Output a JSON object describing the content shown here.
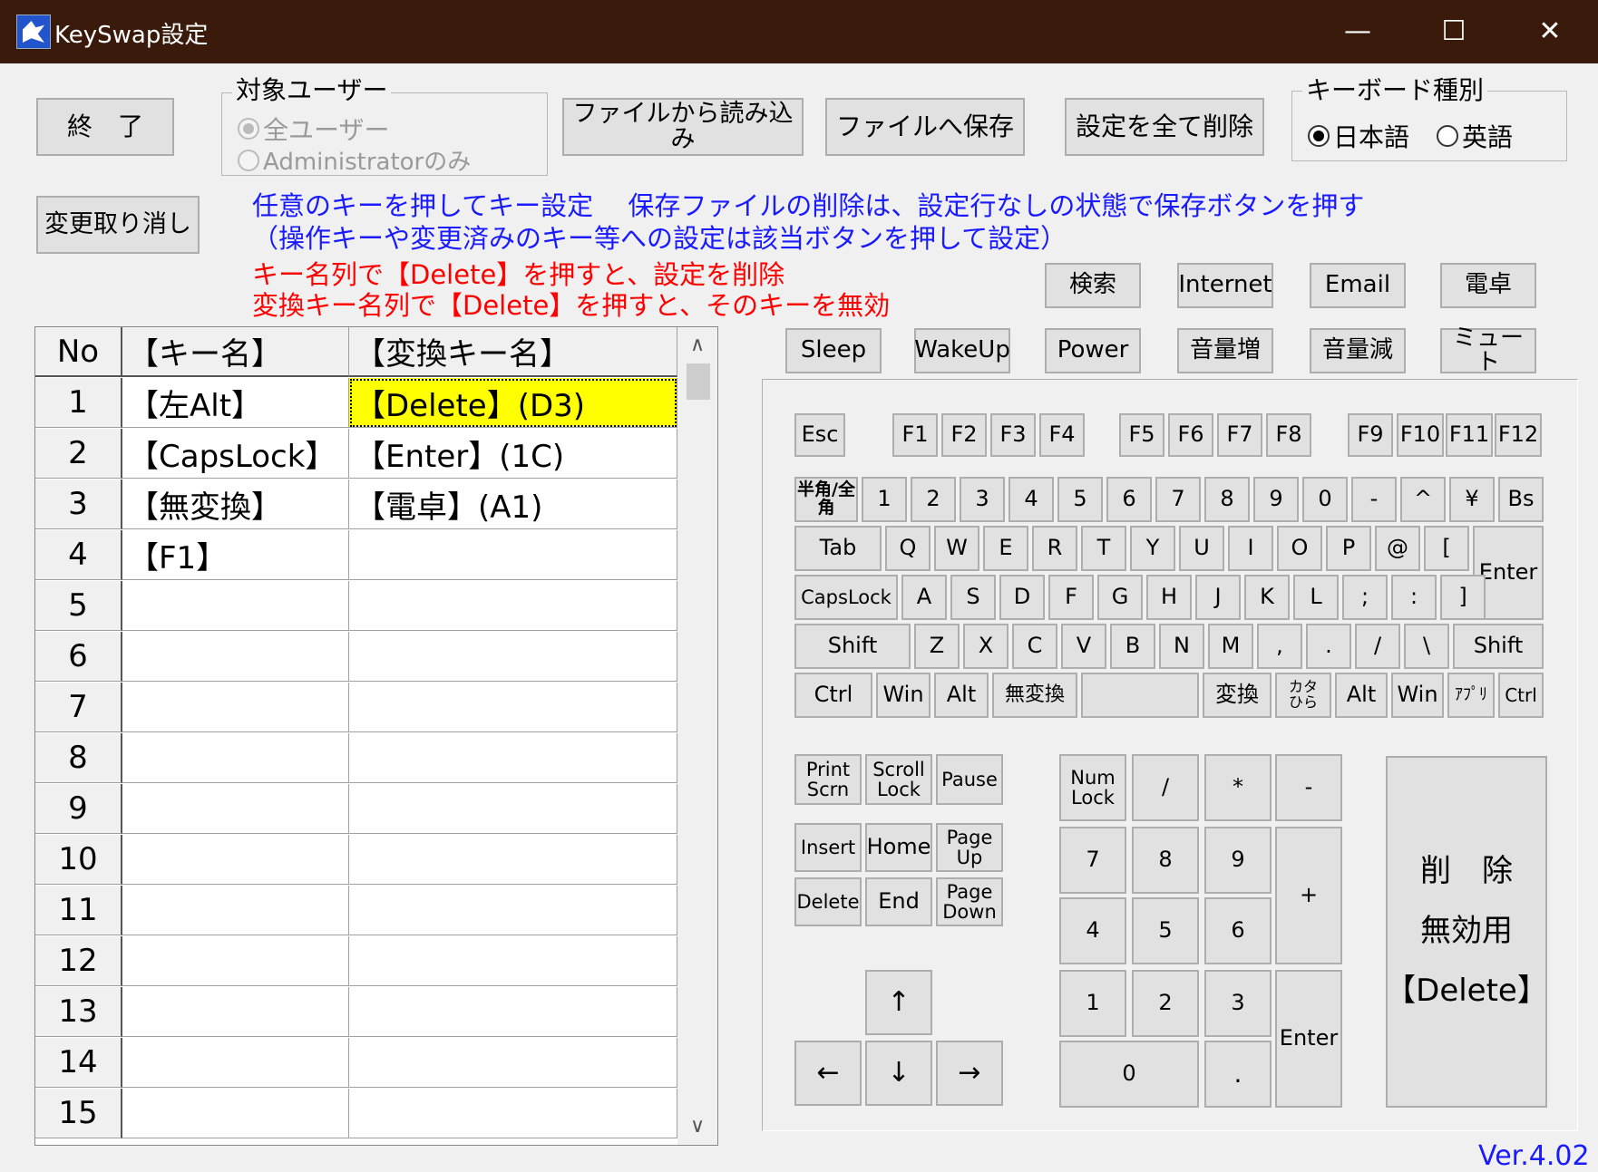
{
  "window": {
    "title": "KeySwap設定",
    "controls": {
      "minimize": "—",
      "maximize": "☐",
      "close": "✕"
    }
  },
  "toolbar": {
    "exit_label": "終　了",
    "undo_label": "変更取り消し",
    "load_label": "ファイルから読み込み",
    "save_label": "ファイルへ保存",
    "delete_all_label": "設定を全て削除"
  },
  "target_user": {
    "legend": "対象ユーザー",
    "options": [
      "全ユーザー",
      "Administratorのみ"
    ]
  },
  "keyboard_type": {
    "legend": "キーボード種別",
    "options": [
      "日本語",
      "英語"
    ]
  },
  "info": {
    "line1": "任意のキーを押してキー設定　 保存ファイルの削除は、設定行なしの状態で保存ボタンを押す",
    "line2": "（操作キーや変更済みのキー等への設定は該当ボタンを押して設定）",
    "line3": "キー名列で【Delete】を押すと、設定を削除",
    "line4": "変換キー名列で【Delete】を押すと、そのキーを無効"
  },
  "special_keys": [
    "検索",
    "Internet",
    "Email",
    "電卓",
    "Sleep",
    "WakeUp",
    "Power",
    "音量増",
    "音量減",
    "ミュート"
  ],
  "grid": {
    "headers": {
      "no": "No",
      "key": "【キー名】",
      "conv": "【変換キー名】"
    },
    "rows": [
      {
        "no": "1",
        "key": "【左Alt】",
        "conv": "【Delete】(D3)"
      },
      {
        "no": "2",
        "key": "【CapsLock】",
        "conv": "【Enter】(1C)"
      },
      {
        "no": "3",
        "key": "【無変換】",
        "conv": "【電卓】(A1)"
      },
      {
        "no": "4",
        "key": "【F1】",
        "conv": ""
      },
      {
        "no": "5",
        "key": "",
        "conv": ""
      },
      {
        "no": "6",
        "key": "",
        "conv": ""
      },
      {
        "no": "7",
        "key": "",
        "conv": ""
      },
      {
        "no": "8",
        "key": "",
        "conv": ""
      },
      {
        "no": "9",
        "key": "",
        "conv": ""
      },
      {
        "no": "10",
        "key": "",
        "conv": ""
      },
      {
        "no": "11",
        "key": "",
        "conv": ""
      },
      {
        "no": "12",
        "key": "",
        "conv": ""
      },
      {
        "no": "13",
        "key": "",
        "conv": ""
      },
      {
        "no": "14",
        "key": "",
        "conv": ""
      },
      {
        "no": "15",
        "key": "",
        "conv": ""
      }
    ],
    "scroll_up": "∧",
    "scroll_down": "∨"
  },
  "keyboard": {
    "esc": "Esc",
    "f": [
      "F1",
      "F2",
      "F3",
      "F4",
      "F5",
      "F6",
      "F7",
      "F8",
      "F9",
      "F10",
      "F11",
      "F12"
    ],
    "hankaku": "半角/全角",
    "numrow": [
      "1",
      "2",
      "3",
      "4",
      "5",
      "6",
      "7",
      "8",
      "9",
      "0",
      "-",
      "^",
      "¥"
    ],
    "bs": "Bs",
    "tab": "Tab",
    "qrow": [
      "Q",
      "W",
      "E",
      "R",
      "T",
      "Y",
      "U",
      "I",
      "O",
      "P",
      "@",
      "["
    ],
    "enter": "Enter",
    "capslock": "CapsLock",
    "arow": [
      "A",
      "S",
      "D",
      "F",
      "G",
      "H",
      "J",
      "K",
      "L",
      ";",
      ":",
      "]"
    ],
    "shift": "Shift",
    "zrow": [
      "Z",
      "X",
      "C",
      "V",
      "B",
      "N",
      "M",
      ",",
      ".",
      "/",
      "\\"
    ],
    "ctrl": "Ctrl",
    "win": "Win",
    "alt": "Alt",
    "muhenkan": "無変換",
    "space": "",
    "henkan": "変換",
    "kana": "カタひら",
    "app": "ｱﾌﾟﾘ",
    "print_scrn": "Print Scrn",
    "scroll_lock": "Scroll Lock",
    "pause": "Pause",
    "insert": "Insert",
    "home": "Home",
    "page_up": "Page Up",
    "delete": "Delete",
    "end": "End",
    "page_down": "Page Down",
    "arrows": {
      "up": "↑",
      "left": "←",
      "down": "↓",
      "right": "→"
    },
    "numpad": {
      "numlock": "Num Lock",
      "div": "/",
      "mul": "*",
      "sub": "-",
      "n7": "7",
      "n8": "8",
      "n9": "9",
      "add": "+",
      "n4": "4",
      "n5": "5",
      "n6": "6",
      "n1": "1",
      "n2": "2",
      "n3": "3",
      "enter": "Enter",
      "n0": "0",
      "dot": "."
    },
    "delete_disable": {
      "line1": "削　除",
      "line2": "無効用",
      "line3": "【Delete】"
    }
  },
  "version": "Ver.4.02"
}
